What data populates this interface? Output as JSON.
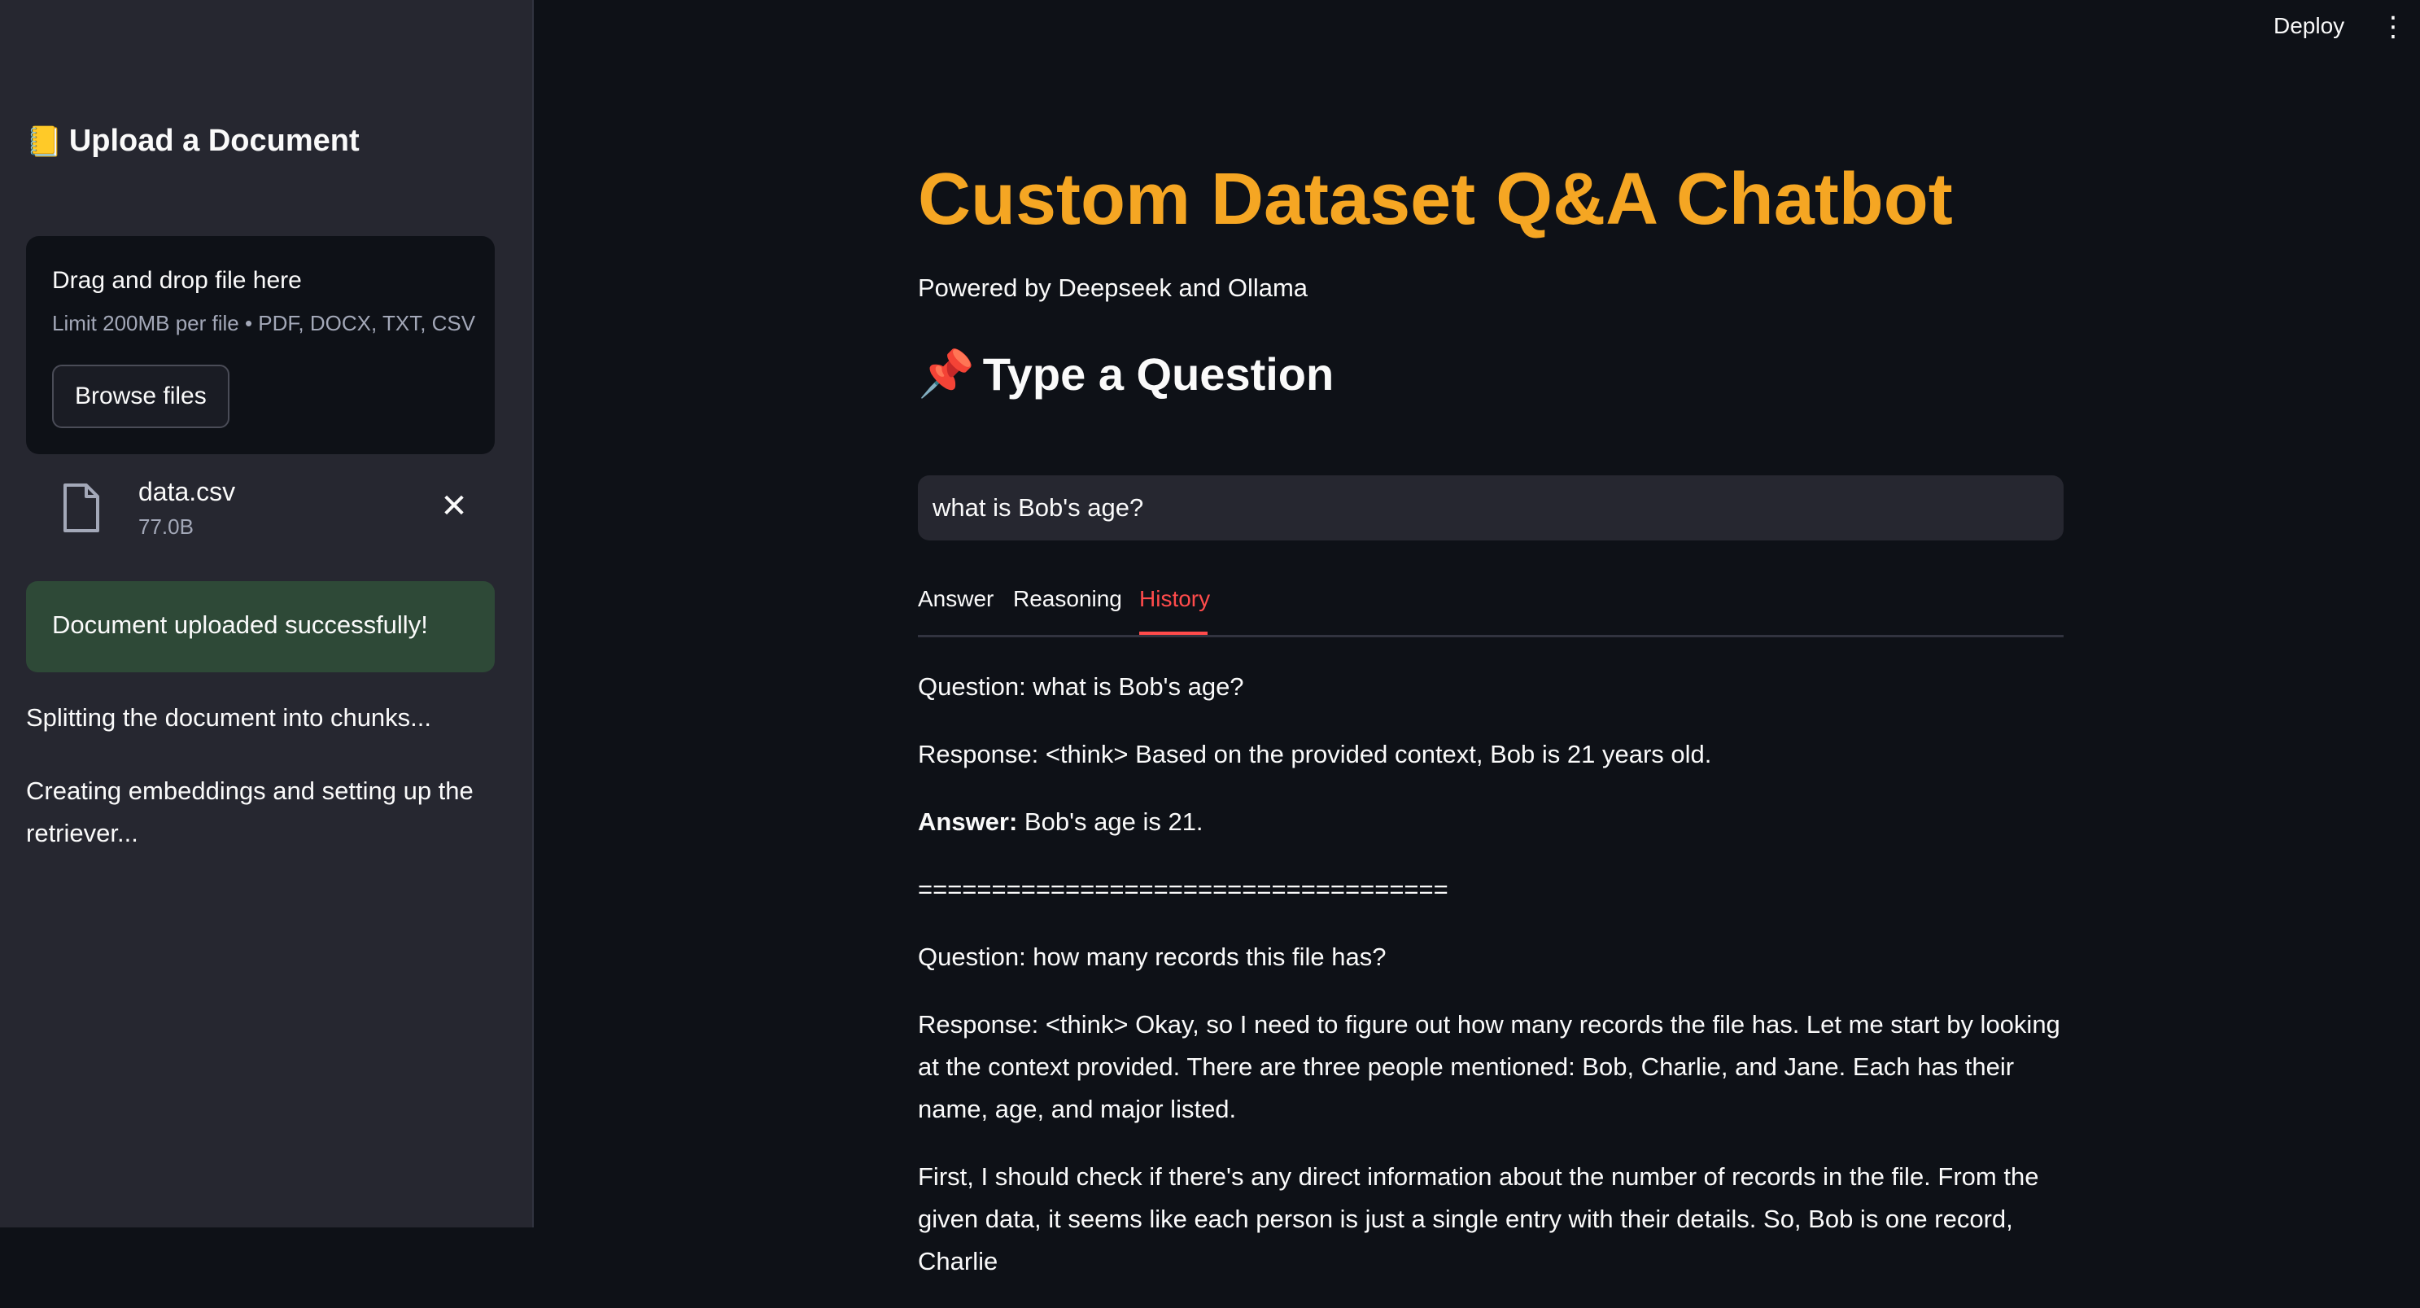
{
  "sidebar": {
    "title_emoji": "📒",
    "title": "Upload a Document",
    "dropzone": {
      "title": "Drag and drop file here",
      "limit": "Limit 200MB per file • PDF, DOCX, TXT, CSV",
      "browse_label": "Browse files"
    },
    "file": {
      "name": "data.csv",
      "size": "77.0B",
      "close_glyph": "✕"
    },
    "success_message": "Document uploaded successfully!",
    "status_split": "Splitting the document into chunks...",
    "status_embed": "Creating embeddings and setting up the retriever..."
  },
  "header": {
    "deploy_label": "Deploy",
    "menu_glyph": "⋮"
  },
  "main": {
    "title": "Custom Dataset Q&A Chatbot",
    "subtitle": "Powered by Deepseek and Ollama",
    "section_emoji": "📌",
    "section_title": "Type a Question",
    "question_value": "what is Bob's age?",
    "tabs": [
      {
        "label": "Answer"
      },
      {
        "label": "Reasoning"
      },
      {
        "label": "History"
      }
    ],
    "active_tab": "History",
    "history": {
      "q1": "Question: what is Bob's age?",
      "r1": "Response: <think> Based on the provided context, Bob is 21 years old.",
      "a1_label": "Answer:",
      "a1_text": " Bob's age is 21.",
      "separator": "====================================",
      "q2": "Question: how many records this file has?",
      "r2": "Response: <think> Okay, so I need to figure out how many records the file has. Let me start by looking at the context provided. There are three people mentioned: Bob, Charlie, and Jane. Each has their name, age, and major listed.",
      "p3": "First, I should check if there's any direct information about the number of records in the file. From the given data, it seems like each person is just a single entry with their details. So, Bob is one record, Charlie"
    }
  },
  "colors": {
    "background": "#0e1117",
    "sidebar": "#262730",
    "title_accent": "#f5a623",
    "active_tab": "#ff4b4b",
    "success_bg": "#2e4937"
  }
}
